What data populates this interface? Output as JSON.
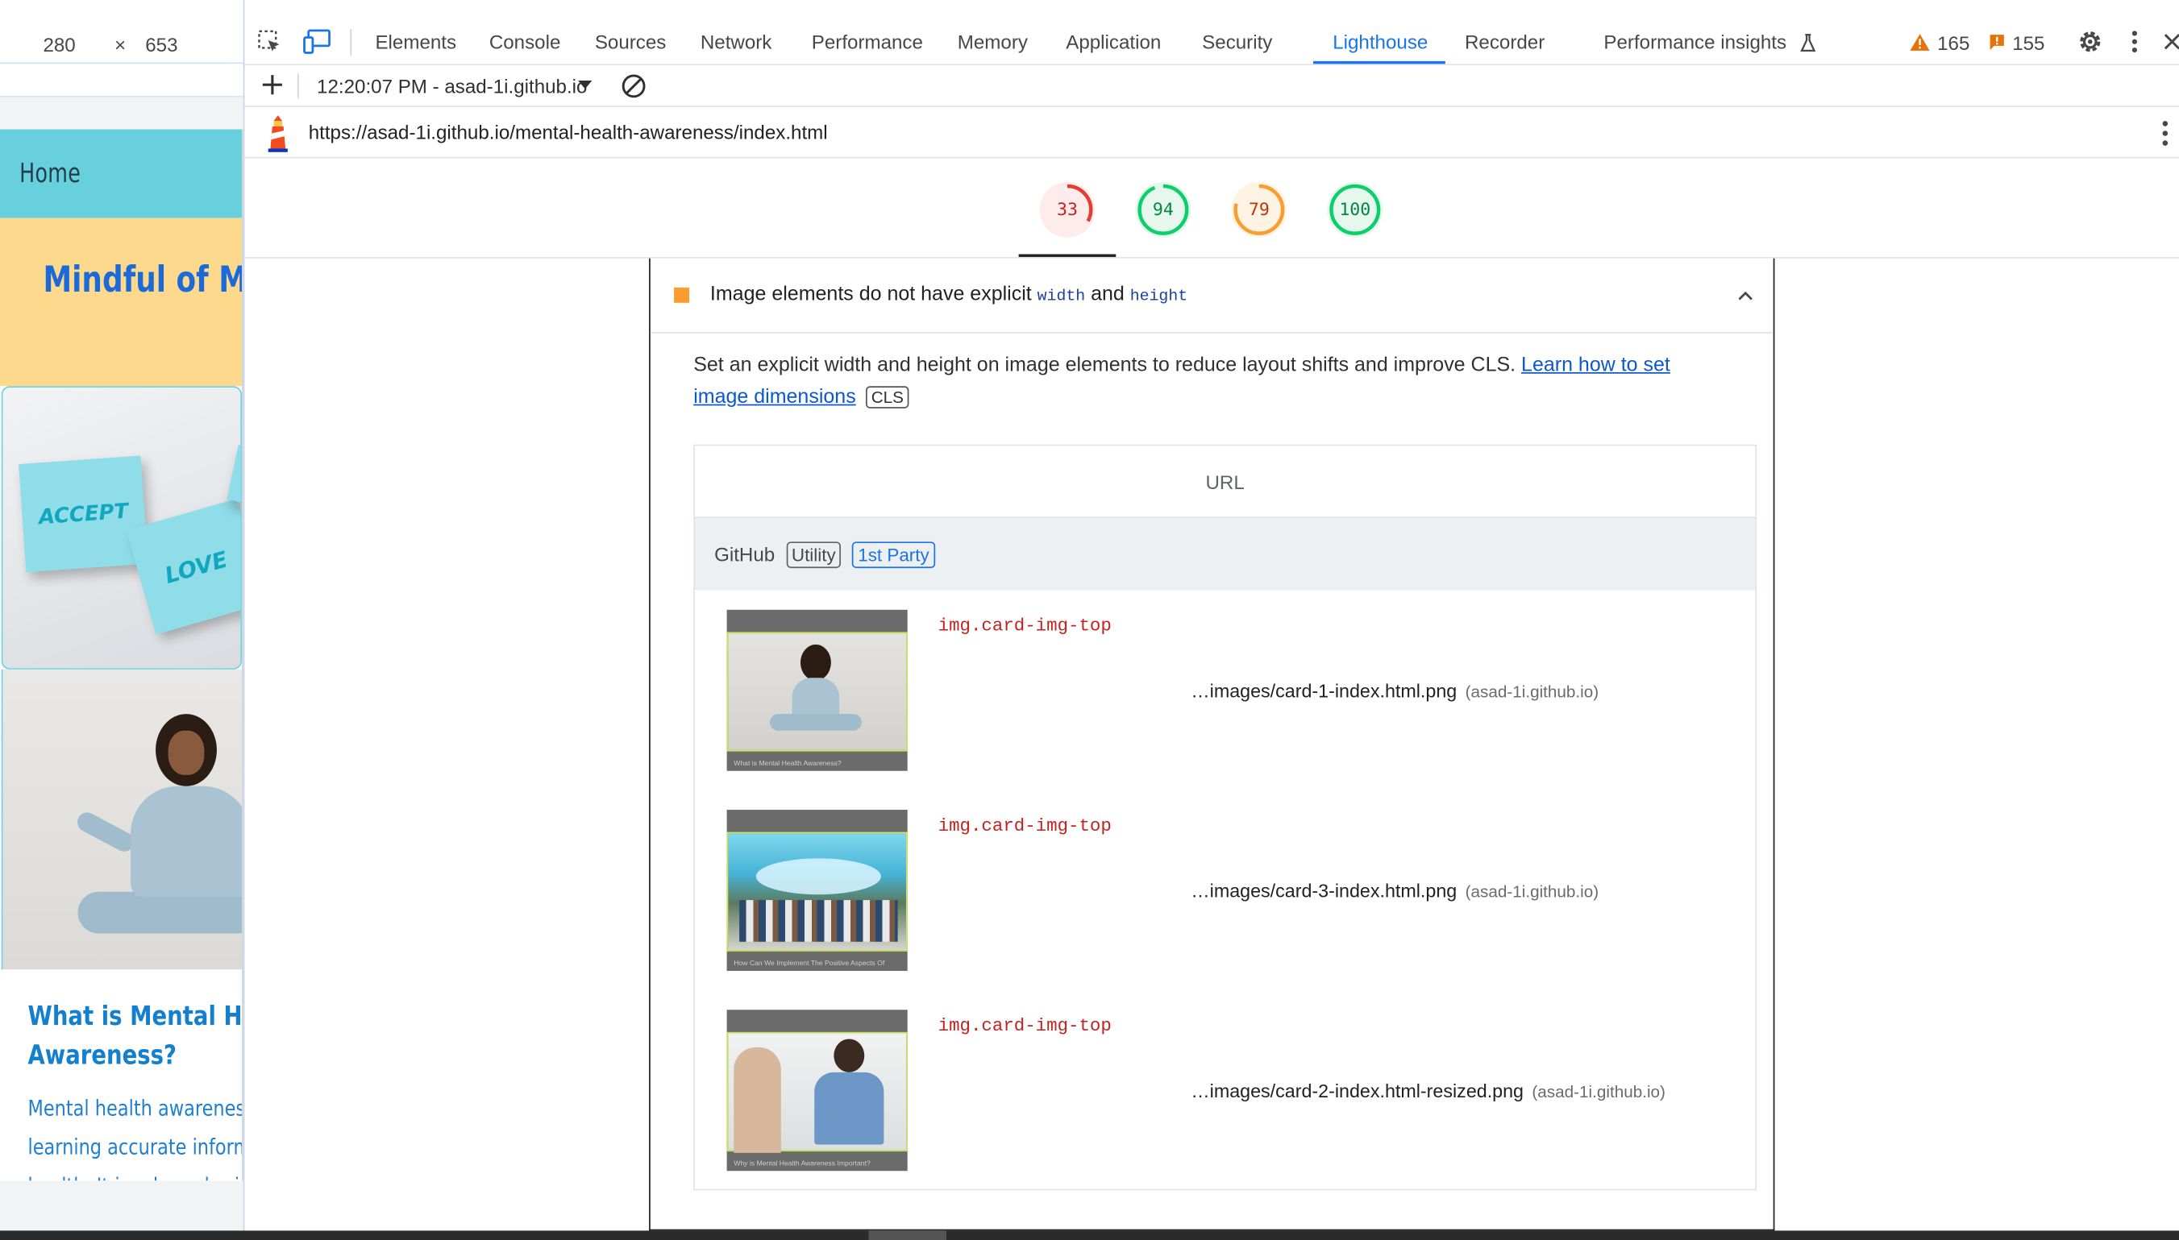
{
  "viewport": {
    "width_value": "280",
    "times_symbol": "×",
    "height_value": "653"
  },
  "site": {
    "nav_label": "Home",
    "hero_title": "Mindful of Me",
    "note_accept": "ACCEPT",
    "note_love": "LOVE",
    "card_title_line1": "What is Mental Hea",
    "card_title_line2": "Awareness?",
    "card_text_line1": "Mental health awareness",
    "card_text_line2": "learning accurate inform",
    "card_text_line3": "health. It involves sharin"
  },
  "devtools": {
    "tabs": [
      "Elements",
      "Console",
      "Sources",
      "Network",
      "Performance",
      "Memory",
      "Application",
      "Security",
      "Lighthouse",
      "Recorder",
      "Performance insights"
    ],
    "active_tab": "Lighthouse",
    "warnings_count": "165",
    "issues_count": "155",
    "report_label": "12:20:07 PM - asad-1i.github.io",
    "url": "https://asad-1i.github.io/mental-health-awareness/index.html",
    "colors": {
      "accent": "#1a73e8",
      "fail": "#e33e32",
      "pass": "#0cce6b",
      "average": "#fa9c2f"
    }
  },
  "scores": [
    {
      "value": "33",
      "fraction": 0.33,
      "status": "fail"
    },
    {
      "value": "94",
      "fraction": 0.94,
      "status": "pass"
    },
    {
      "value": "79",
      "fraction": 0.79,
      "status": "average"
    },
    {
      "value": "100",
      "fraction": 1.0,
      "status": "pass"
    }
  ],
  "audit": {
    "title_prefix": "Image elements do not have explicit ",
    "code_width": "width",
    "title_and": " and ",
    "code_height": "height",
    "description": "Set an explicit width and height on image elements to reduce layout shifts and improve CLS. ",
    "learn_link": "Learn how to set image dimensions",
    "metric_chip": "CLS",
    "table_header": "URL",
    "group": {
      "entity": "GitHub",
      "chip_utility": "Utility",
      "chip_party": "1st Party"
    },
    "rows": [
      {
        "selector": "img.card-img-top",
        "path": "…images/card-1-index.html.png",
        "host": "(asad-1i.github.io)",
        "caption": "What is Mental Health Awareness?"
      },
      {
        "selector": "img.card-img-top",
        "path": "…images/card-3-index.html.png",
        "host": "(asad-1i.github.io)",
        "caption": "How Can We Implement The Positive Aspects Of"
      },
      {
        "selector": "img.card-img-top",
        "path": "…images/card-2-index.html-resized.png",
        "host": "(asad-1i.github.io)",
        "caption": "Why is Mental Health Awareness Important?"
      }
    ]
  }
}
